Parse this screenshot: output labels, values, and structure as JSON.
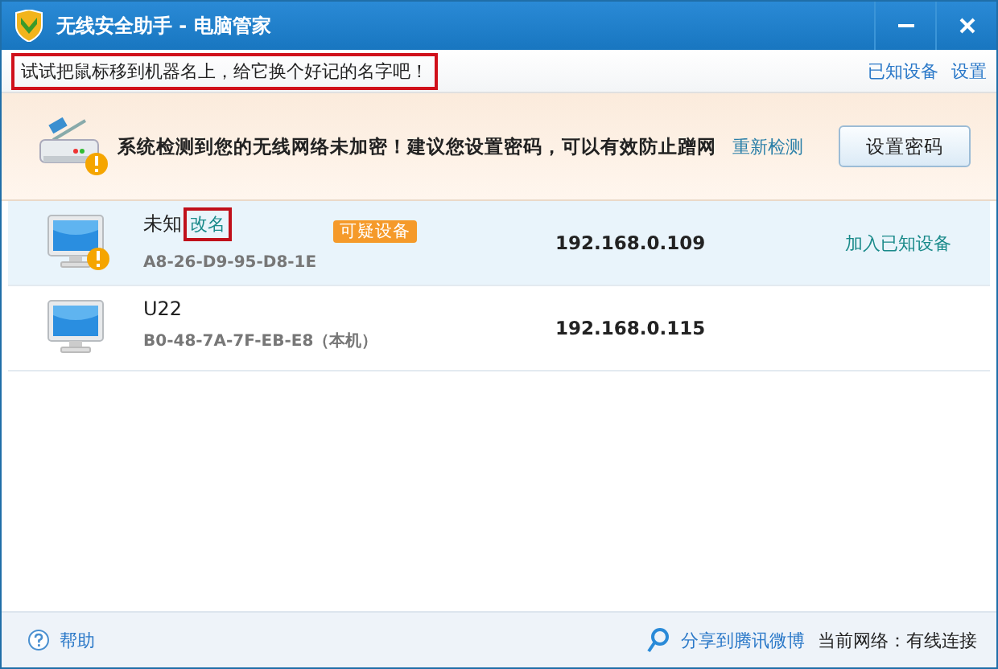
{
  "window": {
    "title": "无线安全助手 - 电脑管家"
  },
  "toolbar": {
    "hint": {
      "text": "试试把鼠标移到机器名上，给它换个好记的名字吧！",
      "highlighted": true
    },
    "links": [
      "已知设备",
      "设置"
    ]
  },
  "banner": {
    "message": "系统检测到您的无线网络未加密！建议您设置密码，可以有效防止蹭网",
    "recheck": "重新检测",
    "button": "设置密码"
  },
  "devices": [
    {
      "name": "未知",
      "rename": {
        "text": "改名",
        "highlighted": true
      },
      "badge": "可疑设备",
      "mac": "A8-26-D9-95-D8-1E",
      "ip": "192.168.0.109",
      "action": "加入已知设备",
      "warning": true,
      "selected": true
    },
    {
      "name": "U22",
      "mac": "B0-48-7A-7F-EB-E8（本机）",
      "ip": "192.168.0.115",
      "warning": false,
      "selected": false
    }
  ],
  "footer": {
    "help": "帮助",
    "share": "分享到腾讯微博",
    "network": "当前网络：有线连接"
  }
}
